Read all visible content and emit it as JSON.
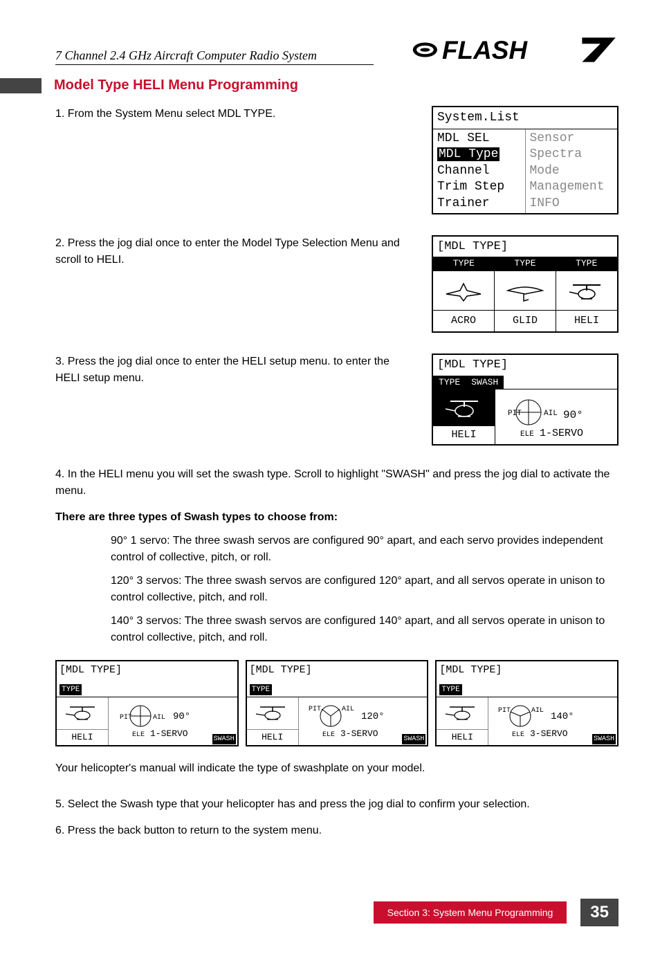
{
  "header": {
    "subtitle": "7 Channel 2.4 GHz Aircraft Computer Radio System",
    "logo_text": "FLASH7"
  },
  "section": {
    "title": "Model Type HELI Menu Programming"
  },
  "steps": {
    "s1": "1. From the System Menu select MDL TYPE.",
    "s2": "2. Press the jog dial once to enter the Model Type Selection Menu and scroll to HELI.",
    "s3": "3. Press the jog dial once to enter the HELI setup menu. to enter the  HELI setup menu.",
    "s4": "4. In the HELI menu you will set the swash type. Scroll to highlight \"SWASH\" and press the jog dial to activate the menu.",
    "s5": "5. Select the Swash type that your helicopter has and press the jog dial to confirm your selection.",
    "s6": "6. Press the back button to return to the system menu."
  },
  "swash": {
    "intro": "There are three types of Swash types to choose from:",
    "opt1": "90° 1 servo: The three swash servos are configured 90° apart, and each servo provides independent control of collective, pitch, or roll.",
    "opt2": "120° 3 servos: The three swash servos are configured 120° apart, and all servos operate in unison to control collective, pitch, and roll.",
    "opt3": "140° 3 servos: The three swash servos are configured 140° apart, and all servos operate in unison to control collective, pitch, and roll.",
    "note": "Your helicopter's manual will indicate the type of swashplate on your model."
  },
  "lcd1": {
    "title": "System.List",
    "left": [
      "MDL SEL",
      "MDL Type",
      "Channel",
      "Trim Step",
      "Trainer"
    ],
    "right": [
      "Sensor",
      "Spectra",
      "Mode",
      "Management",
      "INFO"
    ]
  },
  "lcd2": {
    "title": "[MDL TYPE]",
    "tabs": [
      "TYPE",
      "TYPE",
      "TYPE"
    ],
    "labels": [
      "ACRO",
      "GLID",
      "HELI"
    ]
  },
  "lcd3": {
    "title": "[MDL TYPE]",
    "tabs": [
      "TYPE",
      "SWASH"
    ],
    "heli": "HELI",
    "detail_pit": "PIT",
    "detail_ail": "AIL",
    "detail_deg": "90°",
    "detail_ele": "ELE",
    "detail_servo": "1-SERVO"
  },
  "small_lcds": [
    {
      "title": "[MDL TYPE]",
      "tab": "TYPE",
      "heli": "HELI",
      "deg": "90°",
      "ele": "ELE",
      "servo": "1-SERVO",
      "swash": "SWASH",
      "pit": "PIT",
      "ail": "AIL"
    },
    {
      "title": "[MDL TYPE]",
      "tab": "TYPE",
      "heli": "HELI",
      "deg": "120°",
      "ele": "ELE",
      "servo": "3-SERVO",
      "swash": "SWASH",
      "pit": "PIT",
      "ail": "AIL"
    },
    {
      "title": "[MDL TYPE]",
      "tab": "TYPE",
      "heli": "HELI",
      "deg": "140°",
      "ele": "ELE",
      "servo": "3-SERVO",
      "swash": "SWASH",
      "pit": "PIT",
      "ail": "AIL"
    }
  ],
  "footer": {
    "section": "Section 3: System Menu Programming",
    "page": "35"
  }
}
